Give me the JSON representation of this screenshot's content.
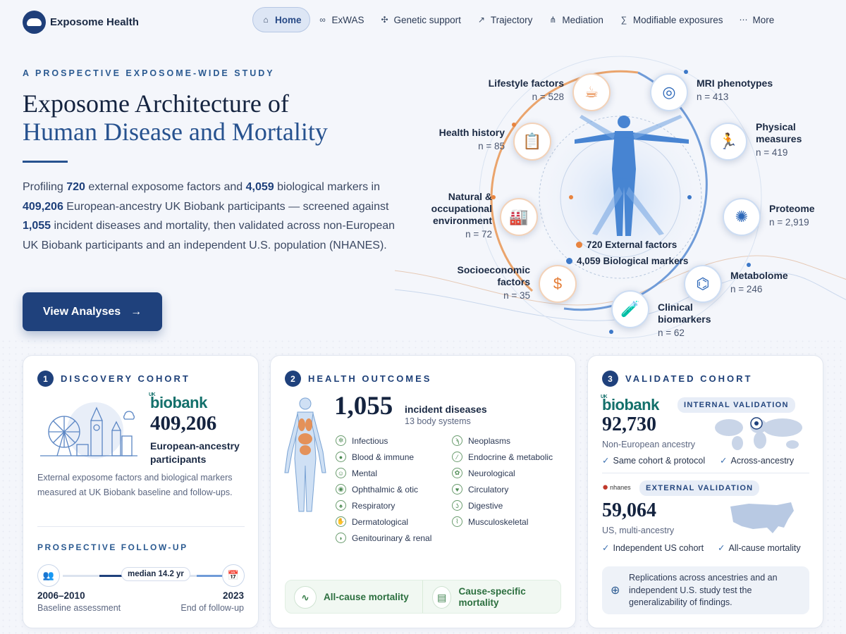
{
  "brand": {
    "name": "Exposome Health"
  },
  "nav": {
    "items": [
      {
        "label": "Home",
        "icon": "home-icon"
      },
      {
        "label": "ExWAS",
        "icon": "link-icon"
      },
      {
        "label": "Genetic support",
        "icon": "dna-icon"
      },
      {
        "label": "Trajectory",
        "icon": "trend-icon"
      },
      {
        "label": "Mediation",
        "icon": "mediation-icon"
      },
      {
        "label": "Modifiable exposures",
        "icon": "sigma-icon"
      },
      {
        "label": "More",
        "icon": "ellipsis-icon"
      }
    ],
    "active": "Home"
  },
  "hero": {
    "eyebrow": "A PROSPECTIVE EXPOSOME-WIDE STUDY",
    "title_line1": "Exposome Architecture of",
    "title_line2": "Human Disease and Mortality",
    "lead": {
      "t1": "Profiling ",
      "n1": "720",
      "t2": " external exposome factors and ",
      "n2": "4,059",
      "t3": " biological markers in ",
      "n3": "409,206",
      "t4": " European-ancestry UK Biobank participants — screened against ",
      "n4": "1,055",
      "t5": " incident diseases and mortality, then validated across non-European UK Biobank participants and an independent U.S. population (NHANES)."
    },
    "cta_label": "View Analyses"
  },
  "diagram": {
    "external": [
      {
        "label": "Lifestyle factors",
        "n": "n = 528"
      },
      {
        "label": "Health history",
        "n": "n = 85"
      },
      {
        "label": "Natural & occupational environment",
        "n": "n = 72"
      },
      {
        "label": "Socioeconomic factors",
        "n": "n = 35"
      }
    ],
    "biological": [
      {
        "label": "MRI phenotypes",
        "n": "n = 413"
      },
      {
        "label": "Physical measures",
        "n": "n = 419"
      },
      {
        "label": "Proteome",
        "n": "n = 2,919"
      },
      {
        "label": "Metabolome",
        "n": "n = 246"
      },
      {
        "label": "Clinical biomarkers",
        "n": "n = 62"
      }
    ],
    "legend_external": "720 External factors",
    "legend_biological": "4,059 Biological markers",
    "colors": {
      "external": "#e8843f",
      "biological": "#3c78c8"
    }
  },
  "cards": {
    "discovery": {
      "num": "1",
      "title": "DISCOVERY COHORT",
      "logo_text": "biobank",
      "logo_prefix": "UK",
      "count": "409,206",
      "subtitle": "European-ancestry participants",
      "desc": "External exposome factors and biological markers measured at UK Biobank baseline and follow-ups.",
      "followup_title": "PROSPECTIVE FOLLOW-UP",
      "median": "median 14.2 yr",
      "start_year": "2006–2010",
      "start_label": "Baseline assessment",
      "end_year": "2023",
      "end_label": "End of follow-up"
    },
    "outcomes": {
      "num": "2",
      "title": "HEALTH OUTCOMES",
      "count": "1,055",
      "count_label": "incident diseases",
      "count_sub": "13 body systems",
      "systems_left": [
        "Infectious",
        "Blood & immune",
        "Mental",
        "Ophthalmic & otic",
        "Respiratory",
        "Dermatological",
        "Genitourinary & renal"
      ],
      "systems_right": [
        "Neoplasms",
        "Endocrine & metabolic",
        "Neurological",
        "Circulatory",
        "Digestive",
        "Musculoskeletal"
      ],
      "mortality_all": "All-cause mortality",
      "mortality_cause": "Cause-specific mortality"
    },
    "validated": {
      "num": "3",
      "title": "VALIDATED COHORT",
      "internal_pill": "INTERNAL VALIDATION",
      "internal_logo": "biobank",
      "internal_logo_prefix": "UK",
      "internal_count": "92,730",
      "internal_desc": "Non-European ancestry",
      "internal_checks": [
        "Same cohort & protocol",
        "Across-ancestry"
      ],
      "external_pill": "EXTERNAL VALIDATION",
      "external_logo": "nhanes",
      "external_count": "59,064",
      "external_desc": "US, multi-ancestry",
      "external_checks": [
        "Independent US cohort",
        "All-cause mortality"
      ],
      "note": "Replications across ancestries and an independent U.S. study test the generalizability of findings."
    }
  }
}
